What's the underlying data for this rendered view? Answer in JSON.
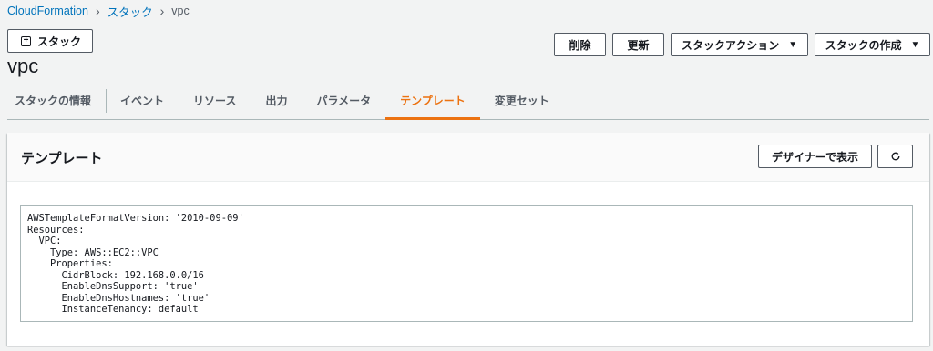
{
  "breadcrumb": {
    "items": [
      "CloudFormation",
      "スタック"
    ],
    "current": "vpc"
  },
  "toolbar": {
    "create_stack_label": "スタック",
    "delete_label": "削除",
    "update_label": "更新",
    "stack_actions_label": "スタックアクション",
    "create_stack_menu_label": "スタックの作成"
  },
  "page": {
    "title": "vpc"
  },
  "tabs": [
    {
      "label": "スタックの情報"
    },
    {
      "label": "イベント"
    },
    {
      "label": "リソース"
    },
    {
      "label": "出力"
    },
    {
      "label": "パラメータ"
    },
    {
      "label": "テンプレート",
      "active": true
    },
    {
      "label": "変更セット"
    }
  ],
  "panel": {
    "title": "テンプレート",
    "designer_label": "デザイナーで表示",
    "template_lines": [
      "AWSTemplateFormatVersion: '2010-09-09'",
      "Resources:",
      "  VPC:",
      "    Type: AWS::EC2::VPC",
      "    Properties:",
      "      CidrBlock: 192.168.0.0/16",
      "      EnableDnsSupport: 'true'",
      "      EnableDnsHostnames: 'true'",
      "      InstanceTenancy: default"
    ]
  },
  "colors": {
    "accent": "#ec7211",
    "link": "#0073bb",
    "text": "#16191f",
    "muted": "#545b64"
  },
  "icons": {
    "add": "plus-box-icon",
    "caret": "caret-down-icon",
    "refresh": "refresh-icon",
    "breadcrumb_sep": "chevron-right-icon"
  }
}
